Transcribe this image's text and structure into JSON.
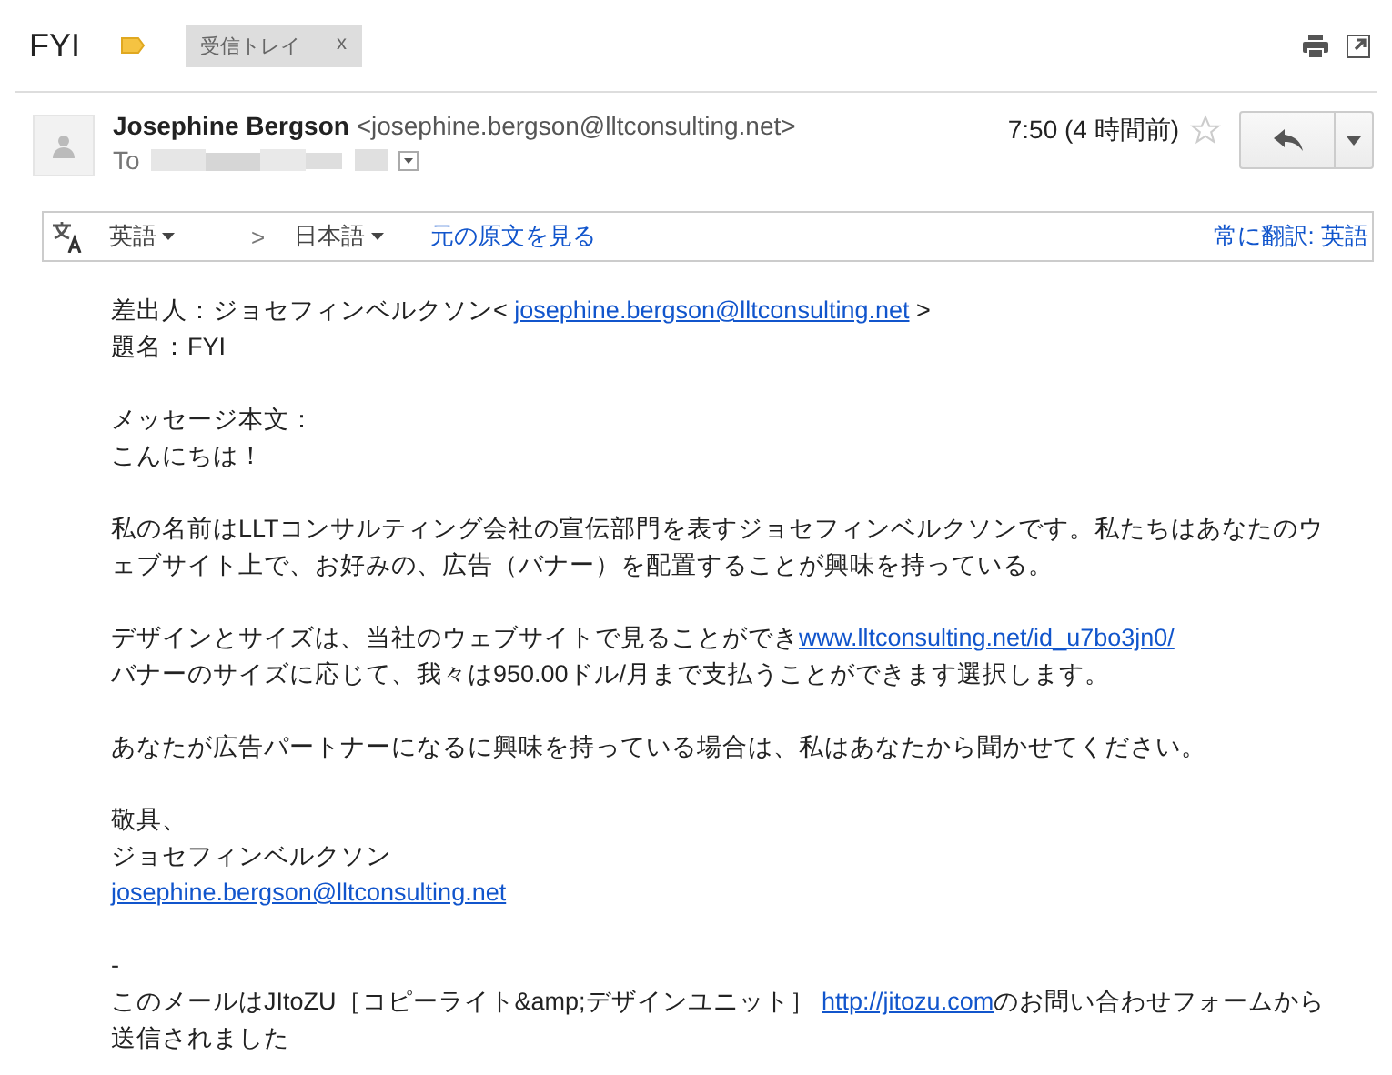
{
  "subject": "FYI",
  "labels": [
    {
      "text": "受信トレイ",
      "remove": "x"
    }
  ],
  "message": {
    "sender_name": "Josephine Bergson",
    "sender_email": "<josephine.bergson@lltconsulting.net>",
    "to_label": "To",
    "time": "7:50 (4 時間前)",
    "starred": false
  },
  "translate_bar": {
    "source": "英語",
    "target": "日本語",
    "separator": ">",
    "show_original": "元の原文を見る",
    "always": "常に翻訳: 英語"
  },
  "body": [
    [
      [
        {
          "kind": "text",
          "text": "差出人：ジョセフィンベルクソン< "
        },
        {
          "kind": "link",
          "text": "josephine.bergson@lltconsulting.net"
        },
        {
          "kind": "text",
          "text": " >"
        }
      ],
      [
        {
          "kind": "text",
          "text": "題名：FYI"
        }
      ]
    ],
    [
      [
        {
          "kind": "text",
          "text": "メッセージ本文："
        }
      ],
      [
        {
          "kind": "text",
          "text": "こんにちは！"
        }
      ]
    ],
    [
      [
        {
          "kind": "text",
          "text": "私の名前はLLTコンサルティング会社の宣伝部門を表すジョセフィンベルクソンです。私たちはあなたのウェブサイト上で、お好みの、広告（バナー）を配置することが興味を持っている。"
        }
      ]
    ],
    [
      [
        {
          "kind": "text",
          "text": "デザインとサイズは、当社のウェブサイトで見ることができ"
        },
        {
          "kind": "link",
          "text": "www.lltconsulting.net/id_u7bo3jn0/"
        }
      ],
      [
        {
          "kind": "text",
          "text": "バナーのサイズに応じて、我々は950.00ドル/月まで支払うことができます選択します。"
        }
      ]
    ],
    [
      [
        {
          "kind": "text",
          "text": "あなたが広告パートナーになるに興味を持っている場合は、私はあなたから聞かせてください。"
        }
      ]
    ],
    [
      [
        {
          "kind": "text",
          "text": "敬具、"
        }
      ],
      [
        {
          "kind": "text",
          "text": "ジョセフィンベルクソン"
        }
      ],
      [
        {
          "kind": "link",
          "text": "josephine.bergson@lltconsulting.net"
        }
      ]
    ],
    [
      [
        {
          "kind": "text",
          "text": "-"
        }
      ],
      [
        {
          "kind": "text",
          "text": "このメールはJItoZU［コピーライト&amp;デザインユニット］ "
        },
        {
          "kind": "link",
          "text": "http://jitozu.com"
        },
        {
          "kind": "text",
          "text": "のお問い合わせフォームから送信されました"
        }
      ]
    ]
  ]
}
